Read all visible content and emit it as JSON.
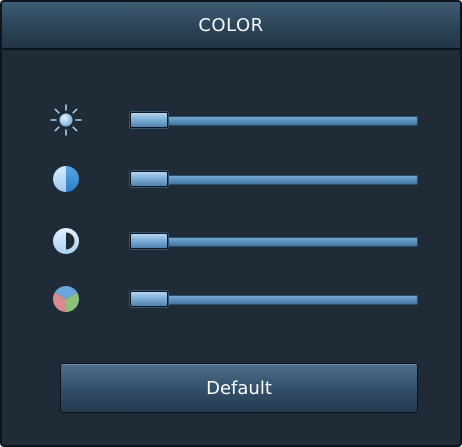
{
  "panel": {
    "title": "COLOR"
  },
  "sliders": [
    {
      "id": "brightness",
      "icon": "sun-icon",
      "value": 0.1
    },
    {
      "id": "contrast",
      "icon": "half-circle-icon",
      "value": 0.1
    },
    {
      "id": "gamma",
      "icon": "contrast-icon",
      "value": 0.1
    },
    {
      "id": "saturation",
      "icon": "color-wheel-icon",
      "value": 0.1
    }
  ],
  "buttons": {
    "default_label": "Default"
  },
  "colors": {
    "background": "#1f2c38",
    "accent": "#5a8fbb",
    "text": "#f2f6fa"
  }
}
